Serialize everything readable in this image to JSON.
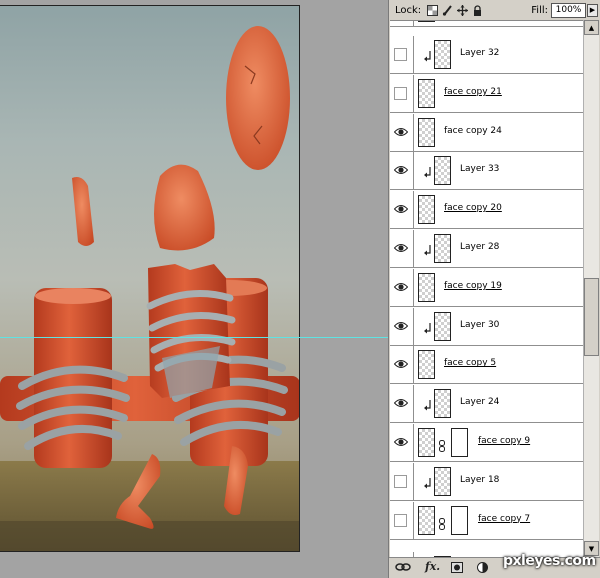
{
  "lock_bar": {
    "lock_label": "Lock:",
    "fill_label": "Fill:",
    "fill_value": "100%"
  },
  "layers": [
    {
      "name": "Layer 32",
      "visible": false,
      "clipped": true,
      "mask": false,
      "underline": false
    },
    {
      "name": "face copy 21",
      "visible": false,
      "clipped": false,
      "mask": false,
      "underline": true
    },
    {
      "name": "face copy 24",
      "visible": true,
      "clipped": false,
      "mask": false,
      "underline": false
    },
    {
      "name": "Layer 33",
      "visible": true,
      "clipped": true,
      "mask": false,
      "underline": false
    },
    {
      "name": "face copy 20",
      "visible": true,
      "clipped": false,
      "mask": false,
      "underline": true
    },
    {
      "name": "Layer 28",
      "visible": true,
      "clipped": true,
      "mask": false,
      "underline": false
    },
    {
      "name": "face copy 19",
      "visible": true,
      "clipped": false,
      "mask": false,
      "underline": true
    },
    {
      "name": "Layer 30",
      "visible": true,
      "clipped": true,
      "mask": false,
      "underline": false
    },
    {
      "name": "face copy 5",
      "visible": true,
      "clipped": false,
      "mask": false,
      "underline": true
    },
    {
      "name": "Layer 24",
      "visible": true,
      "clipped": true,
      "mask": false,
      "underline": false
    },
    {
      "name": "face copy 9",
      "visible": true,
      "clipped": false,
      "mask": true,
      "underline": true
    },
    {
      "name": "Layer 18",
      "visible": false,
      "clipped": true,
      "mask": false,
      "underline": false
    },
    {
      "name": "face copy 7",
      "visible": false,
      "clipped": false,
      "mask": true,
      "underline": true
    }
  ],
  "watermark": "pxleyes.com",
  "colors": {
    "panel_bg": "#d4d0c8",
    "guide": "#5fe3e3",
    "canvas_bg": "#a3a3a3"
  },
  "icons": {
    "lock": [
      "lock-transparent-icon",
      "lock-paint-icon",
      "lock-move-icon",
      "lock-all-icon"
    ],
    "bottom": [
      "link-layers-icon",
      "fx-icon",
      "add-mask-icon",
      "adjustment-layer-icon"
    ]
  }
}
